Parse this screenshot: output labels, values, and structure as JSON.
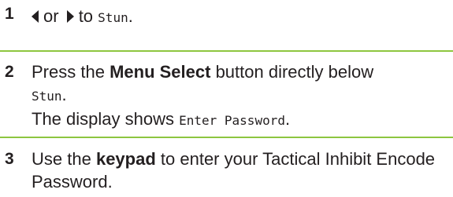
{
  "steps": [
    {
      "number": "1",
      "connector": "or",
      "lead": "to",
      "mono_term": "Stun",
      "end": ".",
      "left_icon": "left-arrow-icon",
      "right_icon": "right-arrow-icon"
    },
    {
      "number": "2",
      "text_before": "Press the",
      "bold_term": "Menu Select",
      "text_after": "button directly below",
      "mono_term": "Stun",
      "end": ".",
      "line2_before": "The display shows",
      "mono_term_2": "Enter Password",
      "line2_end": "."
    },
    {
      "number": "3",
      "text_before": "Use the",
      "bold_term": "keypad",
      "text_after": "to enter your Tactical Inhibit Encode Password."
    }
  ],
  "colors": {
    "rule": "#8dc63f",
    "text": "#231f20"
  }
}
